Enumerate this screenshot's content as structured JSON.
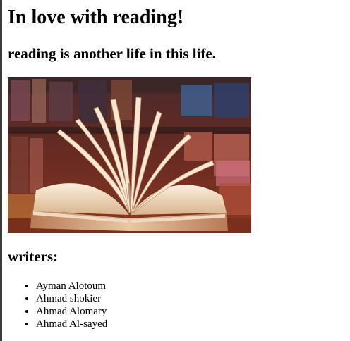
{
  "page": {
    "title": "In love with reading!",
    "subtitle": "reading is another life in this life.",
    "image_subject": "open-book",
    "writers_heading": "writers:",
    "writers": [
      "Ayman Alotoum",
      "Ahmad shokier",
      "Ahmad Alomary",
      "Ahmad Al-sayed"
    ]
  },
  "colors": {
    "background": "#ffffff",
    "text": "#000000",
    "left_edge": "#3a3a3a"
  }
}
